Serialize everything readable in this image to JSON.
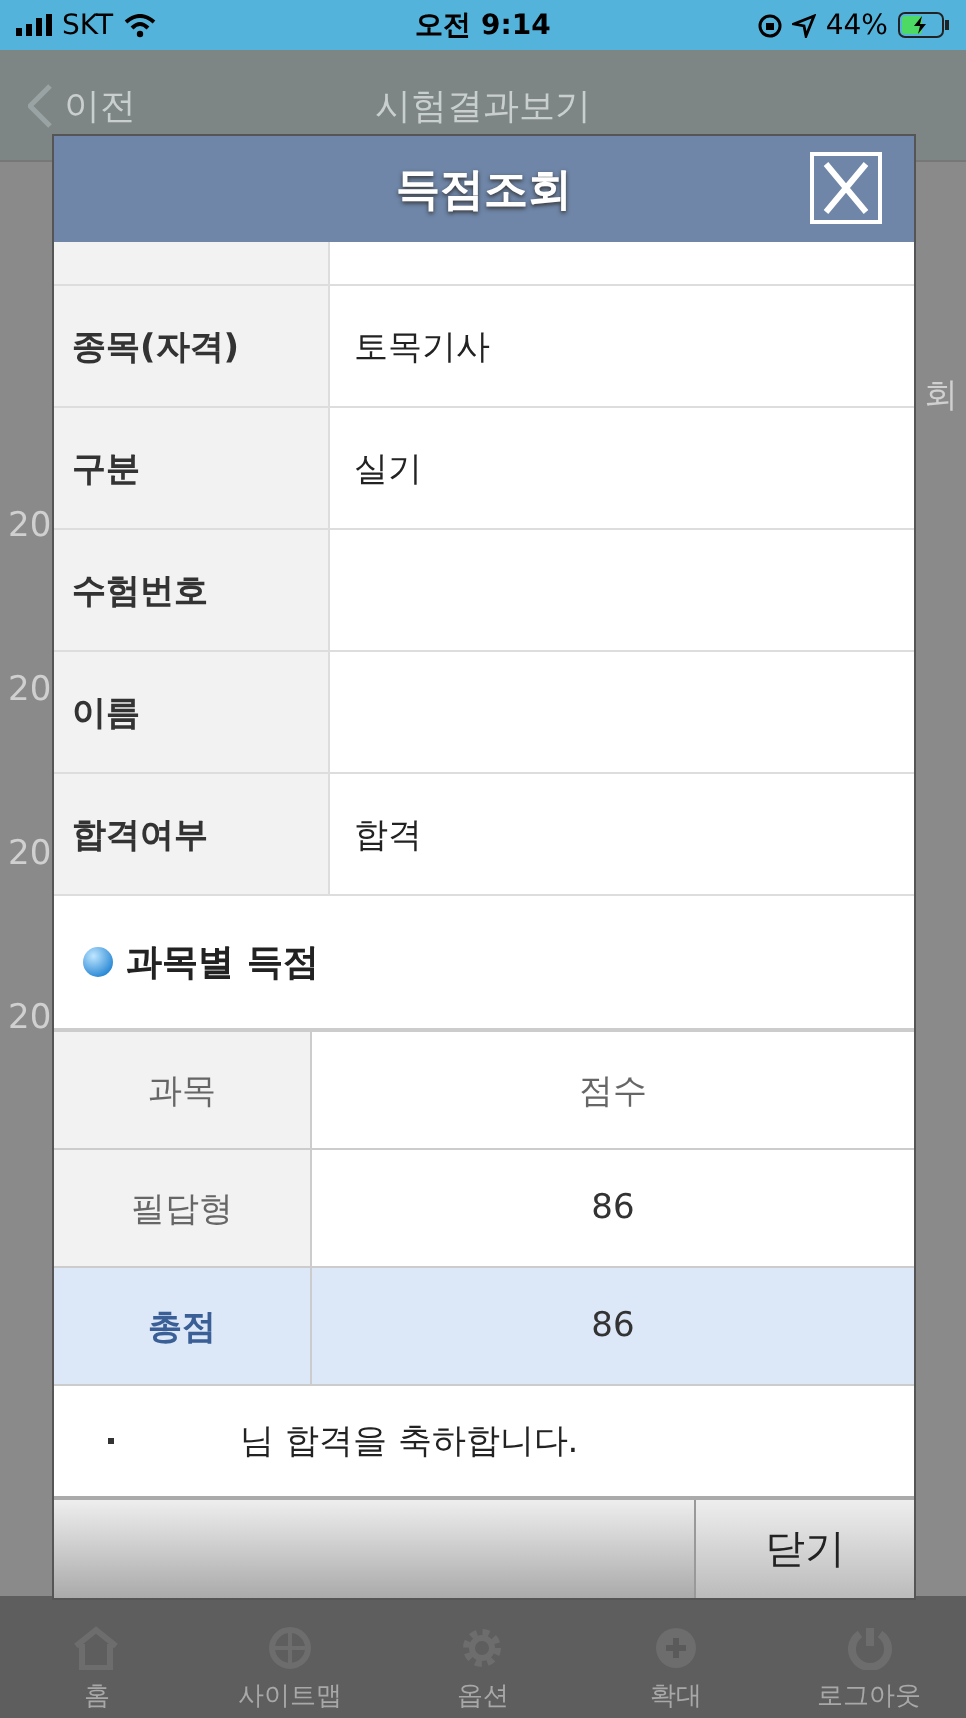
{
  "status_bar": {
    "carrier": "SKT",
    "time": "오전 9:14",
    "battery": "44%"
  },
  "nav": {
    "back": "이전",
    "title": "시험결과보기"
  },
  "background_list": {
    "header_fragment": "회",
    "row_fragments": [
      "20",
      "20",
      "20",
      "20"
    ]
  },
  "modal": {
    "title": "득점조회",
    "info_rows": [
      {
        "label": "종목(자격)",
        "value": "토목기사"
      },
      {
        "label": "구분",
        "value": "실기"
      },
      {
        "label": "수험번호"
      },
      {
        "label": "이름"
      },
      {
        "label": "합격여부",
        "value": "합격"
      }
    ],
    "section_title": "과목별 득점",
    "score_table": {
      "columns": [
        "과목",
        "점수"
      ],
      "rows": [
        {
          "kind": "subject",
          "subject": "필답형",
          "score": "86"
        },
        {
          "kind": "total",
          "subject": "총점",
          "score": "86"
        }
      ]
    },
    "message": "님 합격을 축하합니다.",
    "close_button": "닫기"
  },
  "tab_bar": [
    {
      "label": "홈"
    },
    {
      "label": "사이트맵"
    },
    {
      "label": "옵션"
    },
    {
      "label": "확대"
    },
    {
      "label": "로그아웃"
    }
  ]
}
